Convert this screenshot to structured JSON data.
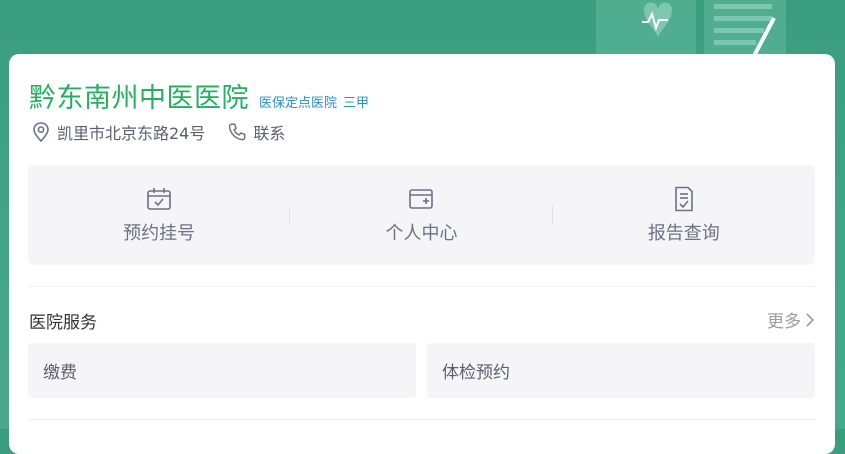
{
  "hospital": {
    "name": "黔东南州中医医院",
    "tags": [
      "医保定点医院",
      "三甲"
    ],
    "address": "凯里市北京东路24号",
    "contact_label": "联系",
    "brand_color": "#24b05f",
    "tag_color": "#2a8fd0"
  },
  "quick_actions": [
    {
      "label": "预约挂号",
      "icon": "calendar-check-icon"
    },
    {
      "label": "个人中心",
      "icon": "card-plus-icon"
    },
    {
      "label": "报告查询",
      "icon": "report-check-icon"
    }
  ],
  "services": {
    "title": "医院服务",
    "more_label": "更多",
    "items": [
      "缴费",
      "体检预约"
    ]
  },
  "icons": {
    "address": "location-pin-icon",
    "contact": "phone-icon",
    "more": "chevron-right-icon",
    "hero": "heart-monitor-icon"
  }
}
